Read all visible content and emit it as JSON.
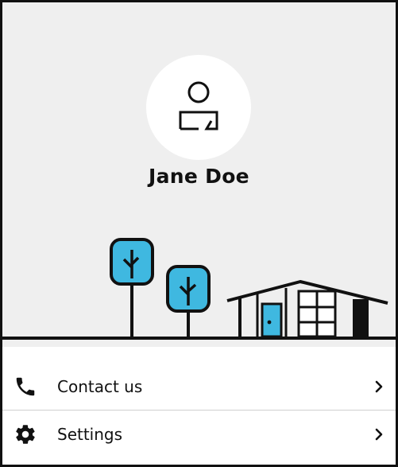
{
  "profile": {
    "name": "Jane Doe",
    "avatar_icon": "user-icon"
  },
  "illustration": {
    "elements": [
      "tree-icon",
      "tree-icon",
      "house-icon"
    ],
    "accent_color": "#3fb8e0"
  },
  "menu": {
    "items": [
      {
        "label": "Contact us",
        "icon": "phone-icon",
        "chevron": "chevron-right-icon"
      },
      {
        "label": "Settings",
        "icon": "gear-icon",
        "chevron": "chevron-right-icon"
      }
    ]
  },
  "colors": {
    "hero_background": "#efefef",
    "text": "#111111",
    "accent": "#3fb8e0"
  }
}
